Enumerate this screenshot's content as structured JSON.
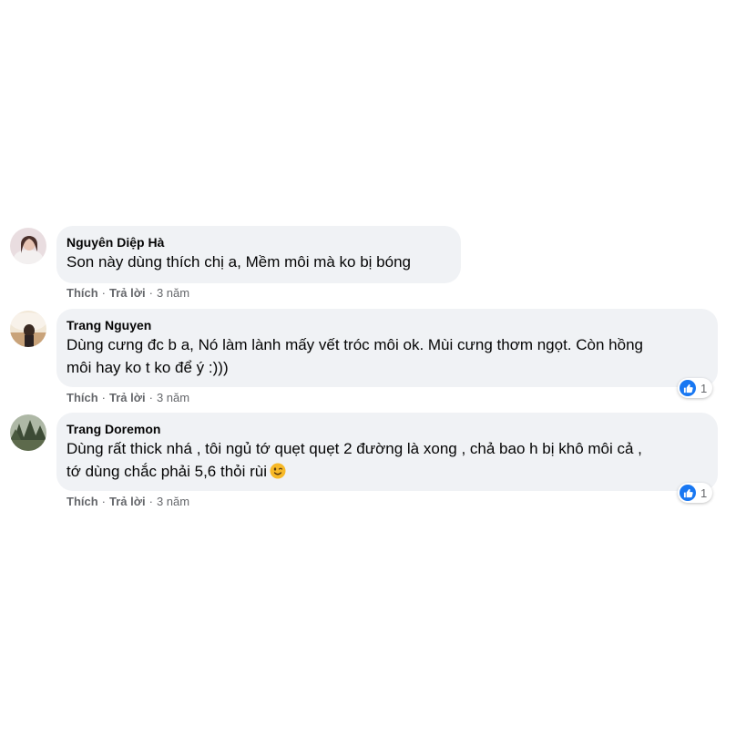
{
  "comments": [
    {
      "author": "Nguyên Diệp Hà",
      "lines": [
        "Son này dùng thích chị a, Mềm môi mà ko bị bóng"
      ],
      "actions": {
        "like": "Thích",
        "reply": "Trả lời",
        "time": "3 năm"
      },
      "reactions": null
    },
    {
      "author": "Trang Nguyen",
      "lines": [
        "Dùng cưng đc b a, Nó làm lành mấy vết tróc môi ok. Mùi cưng thơm ngọt. Còn hồng",
        "môi hay ko t ko để ý :)))"
      ],
      "actions": {
        "like": "Thích",
        "reply": "Trả lời",
        "time": "3 năm"
      },
      "reactions": {
        "icon": "like-icon",
        "count": "1"
      }
    },
    {
      "author": "Trang Doremon",
      "lines": [
        "Dùng rất thick nhá , tôi ngủ tớ quẹt quẹt 2 đường là xong , chả bao h bị khô môi cả ,",
        "tớ dùng chắc phải 5,6 thỏi rùi"
      ],
      "emoji": "wink-face-icon",
      "actions": {
        "like": "Thích",
        "reply": "Trả lời",
        "time": "3 năm"
      },
      "reactions": {
        "icon": "like-icon",
        "count": "1"
      }
    }
  ],
  "colors": {
    "bubble": "#f0f2f5",
    "meta": "#65676b",
    "like": "#1877f2"
  }
}
